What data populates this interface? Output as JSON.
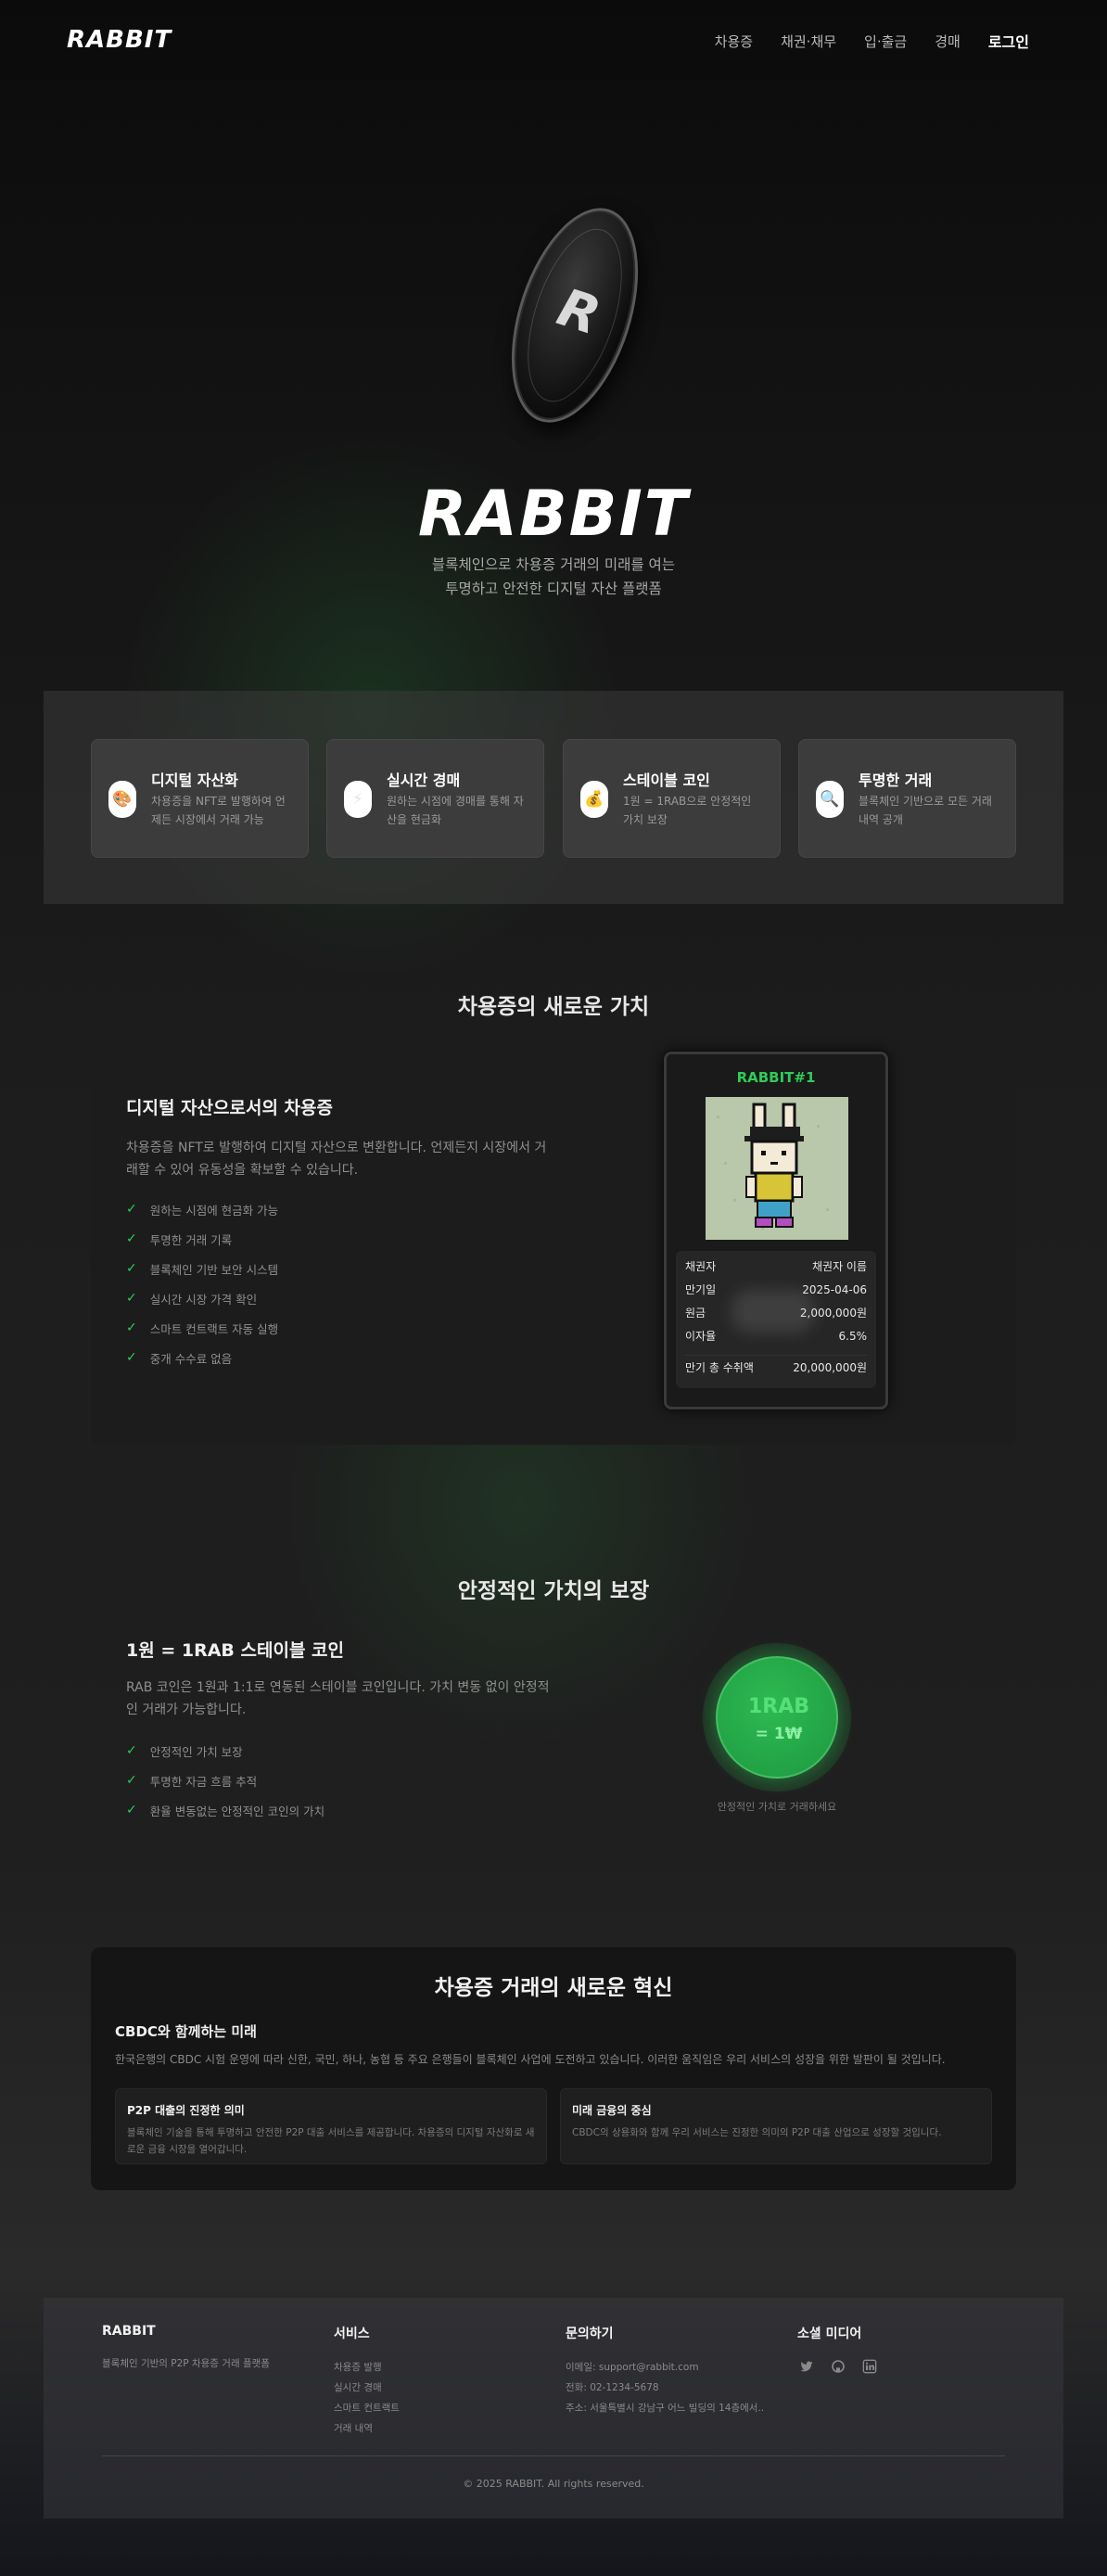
{
  "header": {
    "logo": "RABBIT",
    "nav": [
      "차용증",
      "채권·채무",
      "입·출금",
      "경매"
    ],
    "login": "로그인"
  },
  "hero": {
    "coin_letter": "R",
    "logo": "RABBIT",
    "subtitle_line1": "블록체인으로 차용증 거래의 미래를 여는",
    "subtitle_line2": "투명하고 안전한 디지털 자산 플랫폼"
  },
  "features": [
    {
      "icon": "palette-icon",
      "glyph": "🎨",
      "title": "디지털 자산화",
      "desc": "차용증을 NFT로 발행하여 언제든 시장에서 거래 가능"
    },
    {
      "icon": "lightning-icon",
      "glyph": "⚡",
      "title": "실시간 경매",
      "desc": "원하는 시점에 경매를 통해 자산을 현금화"
    },
    {
      "icon": "money-bag-icon",
      "glyph": "💰",
      "title": "스테이블 코인",
      "desc": "1원 = 1RAB으로 안정적인 가치 보장"
    },
    {
      "icon": "magnifier-icon",
      "glyph": "🔍",
      "title": "투명한 거래",
      "desc": "블록체인 기반으로 모든 거래 내역 공개"
    }
  ],
  "section2": {
    "title": "차용증의 새로운 가치",
    "subtitle": "디지털 자산으로서의 차용증",
    "desc": "차용증을 NFT로 발행하여 디지털 자산으로 변환합니다. 언제든지 시장에서 거래할 수 있어 유동성을 확보할 수 있습니다.",
    "checks": [
      "원하는 시점에 현금화 가능",
      "투명한 거래 기록",
      "블록체인 기반 보안 시스템",
      "실시간 시장 가격 확인",
      "스마트 컨트랙트 자동 실행",
      "중개 수수료 없음"
    ],
    "nft": {
      "title": "RABBIT#1",
      "rows": [
        {
          "label": "채권자",
          "value": "채권자 이름"
        },
        {
          "label": "만기일",
          "value": "2025-04-06"
        },
        {
          "label": "원금",
          "value": "2,000,000원"
        },
        {
          "label": "이자율",
          "value": "6.5%"
        }
      ],
      "total_label": "만기 총 수취액",
      "total_value": "20,000,000원"
    }
  },
  "section3": {
    "title": "안정적인 가치의 보장",
    "subtitle": "1원 = 1RAB 스테이블 코인",
    "desc": "RAB 코인은 1원과 1:1로 연동된 스테이블 코인입니다. 가치 변동 없이 안정적인 거래가 가능합니다.",
    "checks": [
      "안정적인 가치 보장",
      "투명한 자금 흐름 추적",
      "환율 변동없는 안정적인 코인의 가치"
    ],
    "coin_line1": "1RAB",
    "coin_line2": "= 1₩",
    "caption": "안정적인 가치로 거래하세요"
  },
  "section4": {
    "title": "차용증 거래의 새로운 혁신",
    "subtitle": "CBDC와 함께하는 미래",
    "desc": "한국은행의 CBDC 시험 운영에 따라 신한, 국민, 하나, 농협 등 주요 은행들이 블록체인 사업에 도전하고 있습니다. 이러한 움직임은 우리 서비스의 성장을 위한 발판이 될 것입니다.",
    "cards": [
      {
        "title": "P2P 대출의 진정한 의미",
        "desc": "블록체인 기술을 통해 투명하고 안전한 P2P 대출 서비스를 제공합니다. 차용증의 디지털 자산화로 새로운 금융 시장을 열어갑니다."
      },
      {
        "title": "미래 금융의 중심",
        "desc": "CBDC의 상용화와 함께 우리 서비스는 진정한 의미의 P2P 대출 산업으로 성장할 것입니다."
      }
    ]
  },
  "footer": {
    "brand_title": "RABBIT",
    "brand_desc": "블록체인 기반의 P2P 차용증 거래 플랫폼",
    "services_title": "서비스",
    "services": [
      "차용증 발행",
      "실시간 경매",
      "스마트 컨트랙트",
      "거래 내역"
    ],
    "contact_title": "문의하기",
    "contact": [
      "이메일: support@rabbit.com",
      "전화: 02-1234-5678",
      "주소: 서울특별시 강남구 어느 빌딩의 14층에서.."
    ],
    "social_title": "소셜 미디어",
    "social_icons": [
      "twitter-icon",
      "github-icon",
      "linkedin-icon"
    ],
    "copyright": "© 2025 RABBIT. All rights reserved."
  },
  "colors": {
    "accent_green": "#2ecc58",
    "card_bg": "#3c3c3c",
    "panel_bg": "#1c1c1c"
  }
}
